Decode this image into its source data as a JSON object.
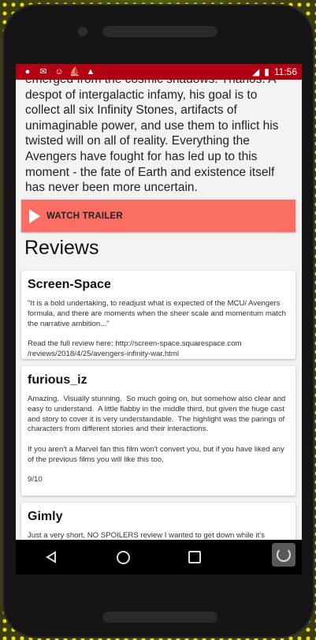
{
  "status_bar": {
    "icons": [
      "location-pin-icon",
      "gmail-icon",
      "smiley-icon",
      "ship-icon",
      "warning-icon"
    ],
    "time": "11:56"
  },
  "overview": {
    "text": "emerged from the cosmic shadows: Thanos. A despot of intergalactic infamy, his goal is to collect all six Infinity Stones, artifacts of unimaginable power, and use them to inflict his twisted will on all of reality. Everything the Avengers have fought for has led up to this moment - the fate of Earth and existence itself has never been more uncertain."
  },
  "trailer_button": {
    "label": "WATCH TRAILER"
  },
  "reviews": {
    "title": "Reviews",
    "items": [
      {
        "author": "Screen-Space",
        "content": "\"It is a bold undertaking, to readjust what is expected of the MCU/ Avengers formula, and there are moments when the sheer scale and momentum match the narrative ambition...\"\n\nRead the full review here: http://screen-space.squarespace.com /reviews/2018/4/25/avengers-infinity-war.html"
      },
      {
        "author": "furious_iz",
        "content": "Amazing.  Visually stunning.  So much going on, but somehow also clear and easy to understand.  A little flabby in the middle third, but given the huge cast and story to cover it is very understandable.  The highlight was the parings of characters from different stories and their interactions.\n\nIf you aren't a Marvel fan this film won't convert you, but if you have liked any of the previous films you will like this too.\n\n9/10"
      },
      {
        "author": "Gimly",
        "content": "Just a very short, NO SPOILERS review I wanted to get down while it's"
      }
    ]
  },
  "colors": {
    "status_bar": "#b00012",
    "trailer_button": "#fa6e63",
    "background": "#f3f3f3"
  }
}
